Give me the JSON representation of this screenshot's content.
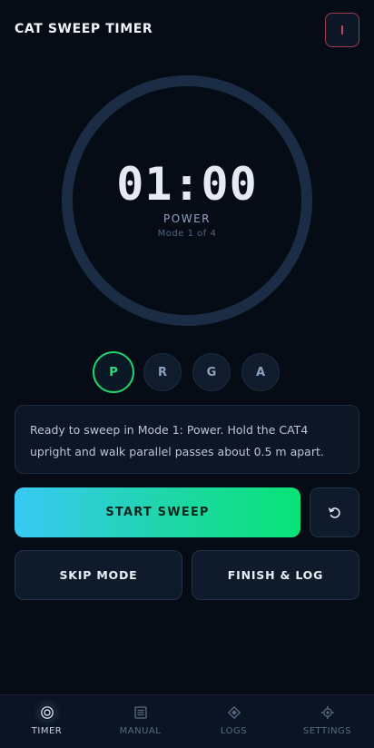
{
  "header": {
    "title": "CAT SWEEP TIMER",
    "action_icon": "stop-icon",
    "action_color": "#a13a4c"
  },
  "timer": {
    "time": "01:00",
    "mode_name": "POWER",
    "mode_count": "Mode 1 of 4",
    "ring_color": "#1b2d45",
    "progress": 0
  },
  "modes": [
    {
      "label": "P",
      "active": true
    },
    {
      "label": "R",
      "active": false
    },
    {
      "label": "G",
      "active": false
    },
    {
      "label": "A",
      "active": false
    }
  ],
  "info": {
    "text": "Ready to sweep in Mode 1: Power. Hold the CAT4 upright and walk parallel passes about 0.5 m apart."
  },
  "actions": {
    "start_label": "START SWEEP",
    "reset_icon": "reset-icon",
    "skip_label": "SKIP MODE",
    "finish_label": "FINISH & LOG"
  },
  "tabs": [
    {
      "label": "TIMER",
      "icon": "timer-icon",
      "active": true
    },
    {
      "label": "MANUAL",
      "icon": "manual-icon",
      "active": false
    },
    {
      "label": "LOGS",
      "icon": "logs-icon",
      "active": false
    },
    {
      "label": "SETTINGS",
      "icon": "settings-icon",
      "active": false
    }
  ],
  "colors": {
    "background": "#060c16",
    "accent_green": "#1fd46e",
    "accent_cyan": "#39c8f5"
  }
}
